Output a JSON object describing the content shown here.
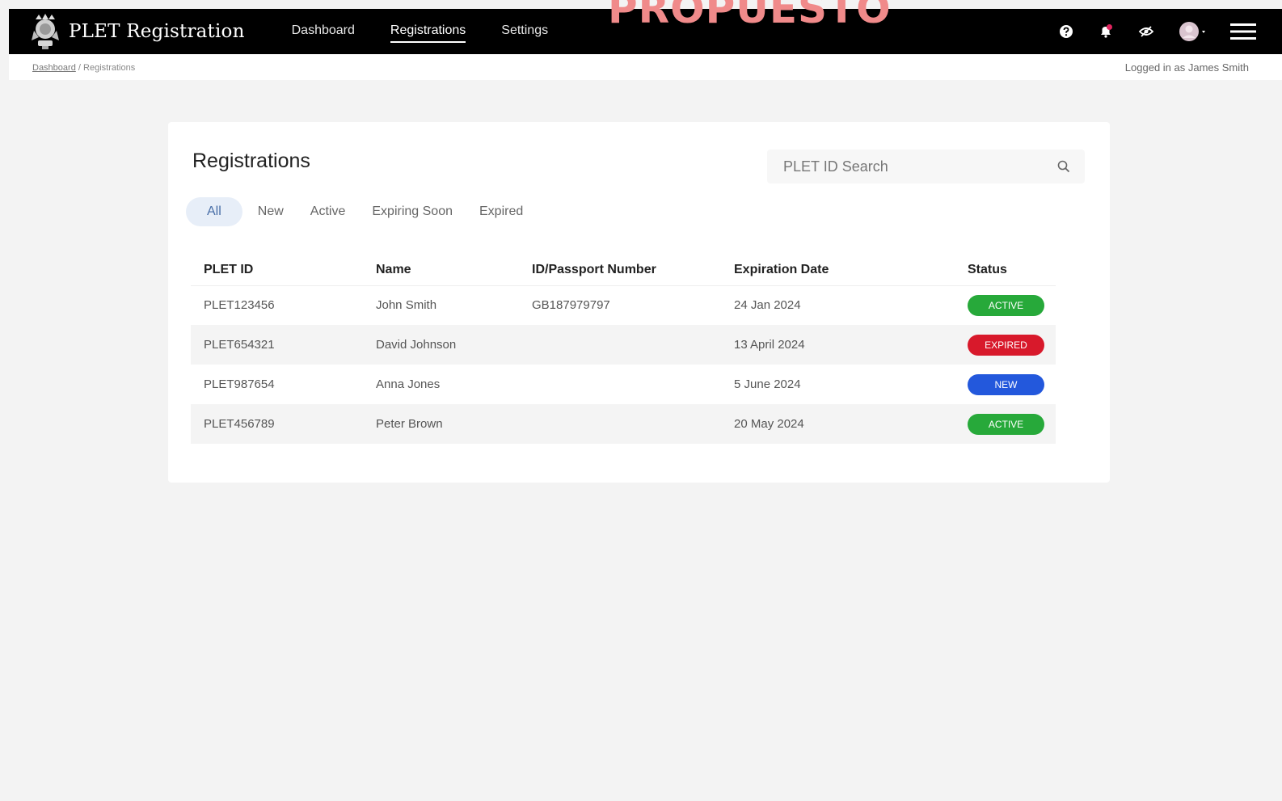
{
  "watermark": "PROPUESTO",
  "app": {
    "title": "PLET Registration"
  },
  "nav": [
    {
      "label": "Dashboard",
      "active": false
    },
    {
      "label": "Registrations",
      "active": true
    },
    {
      "label": "Settings",
      "active": false
    }
  ],
  "icons": {
    "help": "help-icon",
    "notifications": "bell-icon",
    "visibility": "eye-off-icon",
    "avatar": "avatar",
    "menu": "hamburger-menu-icon"
  },
  "breadcrumb": {
    "home": "Dashboard",
    "separator": "/",
    "current": "Registrations"
  },
  "user": {
    "logged_in": "Logged in as James Smith"
  },
  "card": {
    "title": "Registrations",
    "search_placeholder": "PLET ID Search"
  },
  "filters": [
    {
      "label": "All",
      "active": true
    },
    {
      "label": "New",
      "active": false
    },
    {
      "label": "Active",
      "active": false
    },
    {
      "label": "Expiring Soon",
      "active": false
    },
    {
      "label": "Expired",
      "active": false
    }
  ],
  "table": {
    "headers": [
      "PLET ID",
      "Name",
      "ID/Passport Number",
      "Expiration Date",
      "Status"
    ],
    "rows": [
      {
        "id": "PLET123456",
        "name": "John Smith",
        "passport": "GB187979797",
        "expiry": "24 Jan 2024",
        "status": "ACTIVE",
        "status_color": "#27a93a"
      },
      {
        "id": "PLET654321",
        "name": "David Johnson",
        "passport": "",
        "expiry": "13 April 2024",
        "status": "EXPIRED",
        "status_color": "#d8192b"
      },
      {
        "id": "PLET987654",
        "name": "Anna Jones",
        "passport": "",
        "expiry": "5 June 2024",
        "status": "NEW",
        "status_color": "#2358dc"
      },
      {
        "id": "PLET456789",
        "name": "Peter Brown",
        "passport": "",
        "expiry": "20 May 2024",
        "status": "ACTIVE",
        "status_color": "#27a93a"
      }
    ]
  },
  "colors": {
    "topbar": "#000000",
    "active": "#27a93a",
    "expired": "#d8192b",
    "new": "#2358dc",
    "filter_active_bg": "#e7eef8"
  }
}
